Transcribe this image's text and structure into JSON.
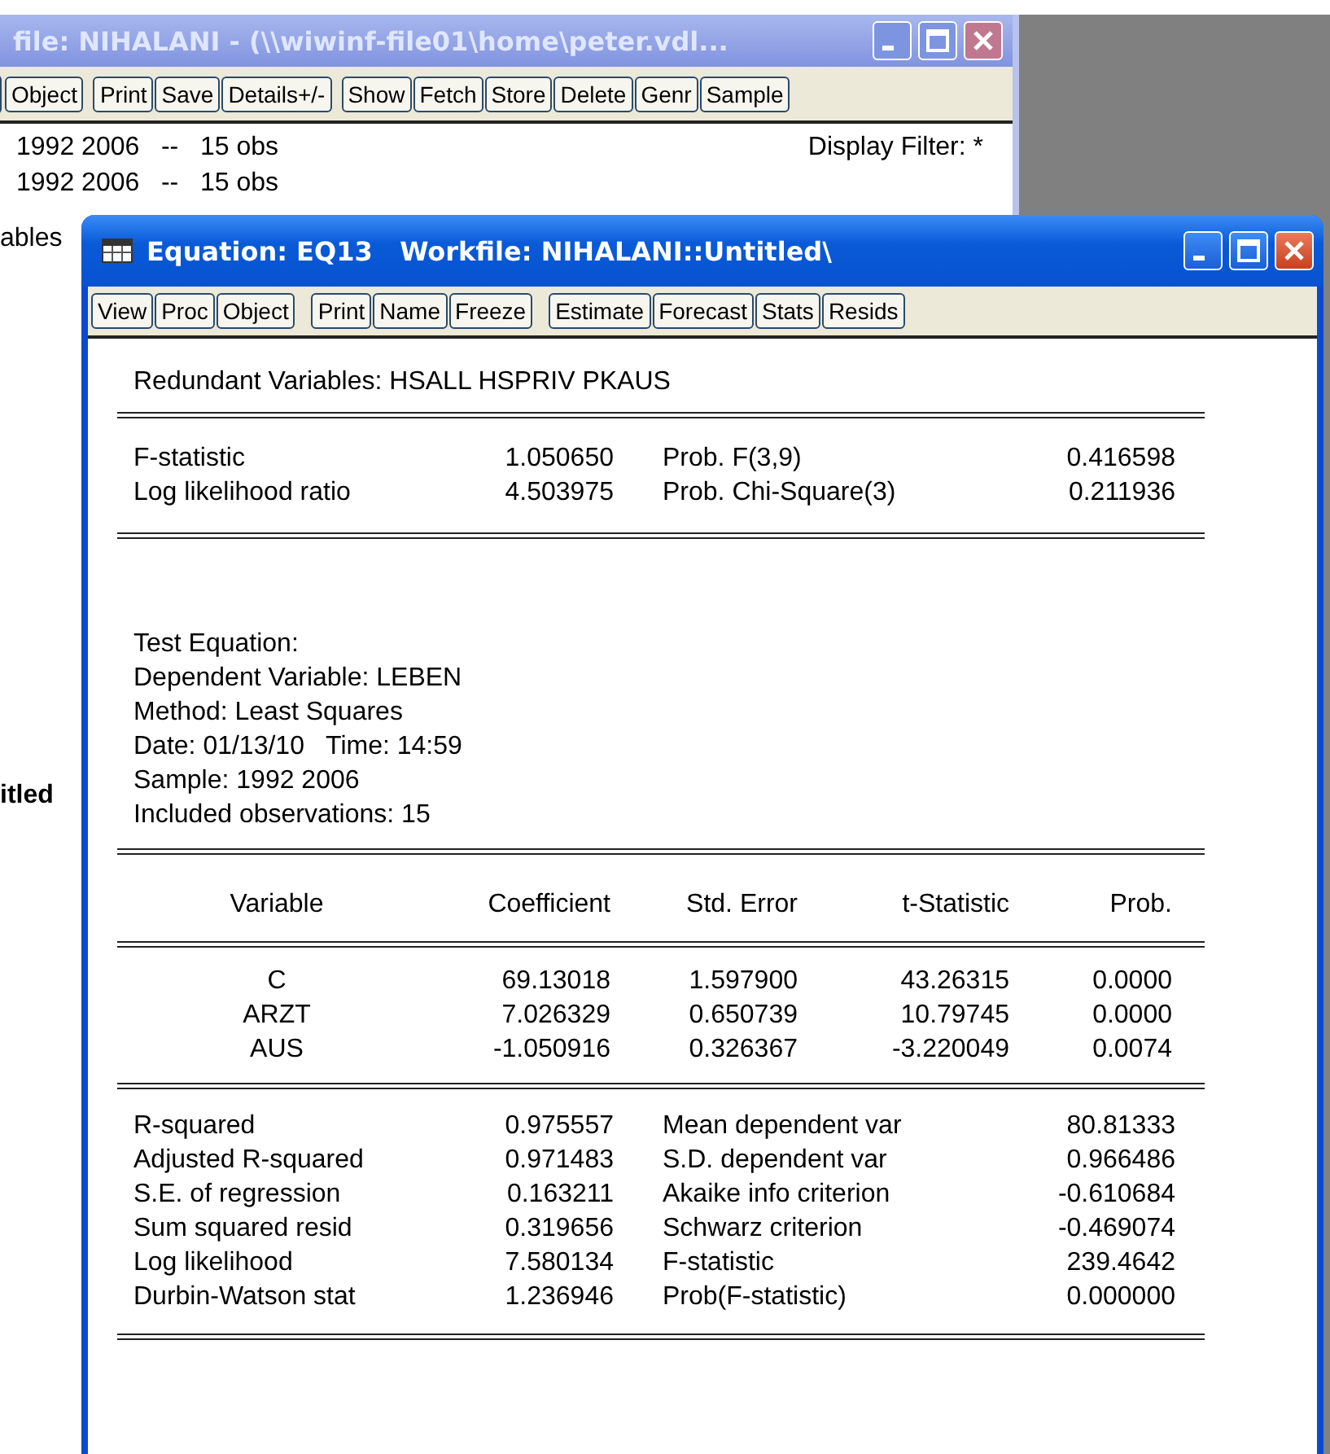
{
  "back_window": {
    "title": "file: NIHALANI - (\\\\wiwinf-file01\\home\\peter.vdl...",
    "toolbar_groups": [
      [
        "Object"
      ],
      [
        "Print",
        "Save",
        "Details+/-"
      ],
      [
        "Show",
        "Fetch",
        "Store",
        "Delete",
        "Genr",
        "Sample"
      ]
    ],
    "range_lines": [
      "1992 2006   --   15 obs",
      "1992 2006   --   15 obs"
    ],
    "display_filter": "Display Filter: *",
    "side_fragments": [
      {
        "text": "ables",
        "bold": false
      },
      {
        "text": "itled",
        "bold": true
      }
    ]
  },
  "front_window": {
    "title": "Equation: EQ13   Workfile: NIHALANI::Untitled\\",
    "toolbar_groups": [
      [
        "View",
        "Proc",
        "Object"
      ],
      [
        "Print",
        "Name",
        "Freeze"
      ],
      [
        "Estimate",
        "Forecast",
        "Stats",
        "Resids"
      ]
    ],
    "heading": "Redundant Variables: HSALL HSPRIV PKAUS",
    "test_stats": [
      [
        "F-statistic",
        "1.050650",
        "Prob. F(3,9)",
        "0.416598"
      ],
      [
        "Log likelihood ratio",
        "4.503975",
        "Prob. Chi-Square(3)",
        "0.211936"
      ]
    ],
    "test_info": [
      "Test Equation:",
      "Dependent Variable: LEBEN",
      "Method: Least Squares",
      "Date: 01/13/10   Time: 14:59",
      "Sample: 1992 2006",
      "Included observations: 15"
    ],
    "coef_columns": [
      "Variable",
      "Coefficient",
      "Std. Error",
      "t-Statistic",
      "Prob."
    ],
    "coef_rows": [
      [
        "C",
        "69.13018",
        "1.597900",
        "43.26315",
        "0.0000"
      ],
      [
        "ARZT",
        "7.026329",
        "0.650739",
        "10.79745",
        "0.0000"
      ],
      [
        "AUS",
        "-1.050916",
        "0.326367",
        "-3.220049",
        "0.0074"
      ]
    ],
    "summary_stats": [
      [
        "R-squared",
        "0.975557",
        "Mean dependent var",
        "80.81333"
      ],
      [
        "Adjusted R-squared",
        "0.971483",
        "S.D. dependent var",
        "0.966486"
      ],
      [
        "S.E. of regression",
        "0.163211",
        "Akaike info criterion",
        "-0.610684"
      ],
      [
        "Sum squared resid",
        "0.319656",
        "Schwarz criterion",
        "-0.469074"
      ],
      [
        "Log likelihood",
        "7.580134",
        "F-statistic",
        "239.4642"
      ],
      [
        "Durbin-Watson stat",
        "1.236946",
        "Prob(F-statistic)",
        "0.000000"
      ]
    ]
  }
}
